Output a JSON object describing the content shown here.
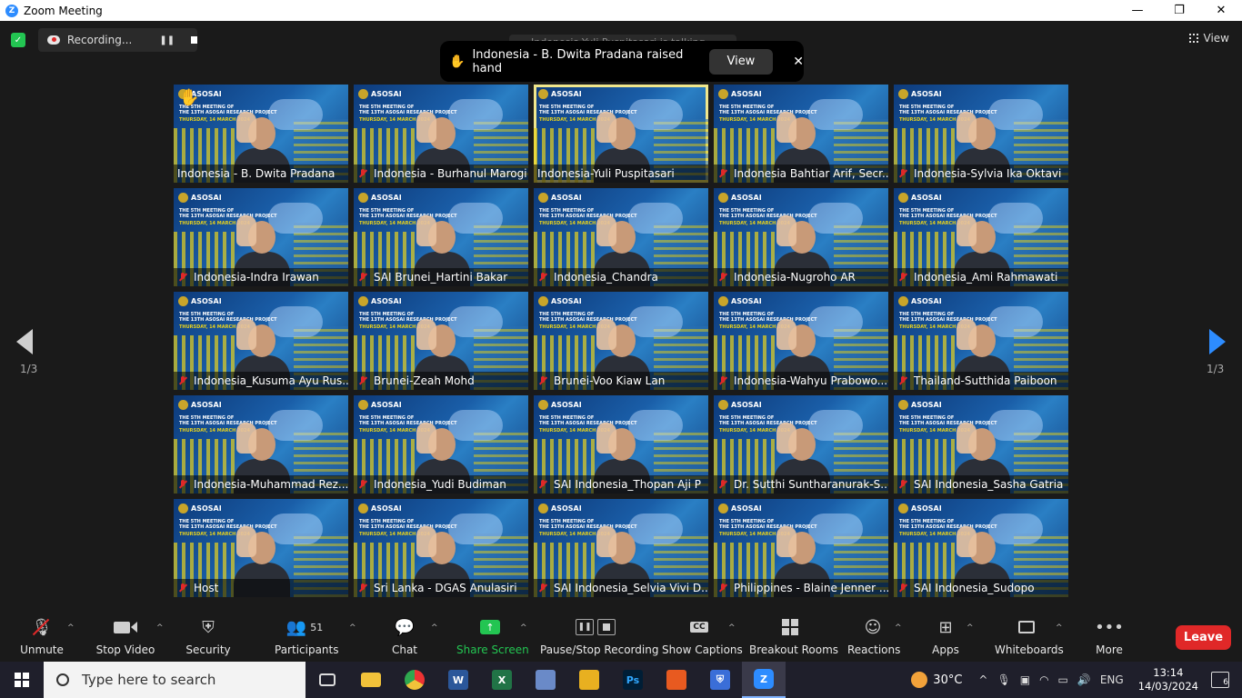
{
  "window": {
    "title": "Zoom Meeting",
    "minimize": "—",
    "maximize": "❐",
    "close": "✕"
  },
  "status": {
    "recording_label": "Recording...",
    "view_label": "View",
    "talking_text": "Indonesia-Yuli Puspitasari is talking..."
  },
  "notification": {
    "text": "Indonesia - B. Dwita Pradana raised hand",
    "view_label": "View",
    "close_label": "✕"
  },
  "tile_header": {
    "org": "ASOSAI",
    "line1": "THE 5TH MEETING OF",
    "line2": "THE 13TH ASOSAI RESEARCH PROJECT",
    "date": "THURSDAY, 14 MARCH 2024"
  },
  "participants": [
    {
      "name": "Indonesia - B. Dwita Pradana",
      "muted": false,
      "raised": true,
      "active": false
    },
    {
      "name": "Indonesia - Burhanul Marogi",
      "muted": true,
      "raised": false,
      "active": false
    },
    {
      "name": "Indonesia-Yuli Puspitasari",
      "muted": false,
      "raised": false,
      "active": true
    },
    {
      "name": "Indonesia Bahtiar Arif, Secr...",
      "muted": true,
      "raised": false,
      "active": false
    },
    {
      "name": "Indonesia-Sylvia Ika Oktavi",
      "muted": true,
      "raised": false,
      "active": false
    },
    {
      "name": "Indonesia-Indra Irawan",
      "muted": true,
      "raised": false,
      "active": false
    },
    {
      "name": "SAI Brunei_Hartini Bakar",
      "muted": true,
      "raised": false,
      "active": false
    },
    {
      "name": "Indonesia_Chandra",
      "muted": true,
      "raised": false,
      "active": false
    },
    {
      "name": "Indonesia-Nugroho AR",
      "muted": true,
      "raised": false,
      "active": false
    },
    {
      "name": "Indonesia_Ami Rahmawati",
      "muted": true,
      "raised": false,
      "active": false
    },
    {
      "name": "Indonesia_Kusuma Ayu Rus...",
      "muted": true,
      "raised": false,
      "active": false
    },
    {
      "name": "Brunei-Zeah Mohd",
      "muted": true,
      "raised": false,
      "active": false
    },
    {
      "name": "Brunei-Voo Kiaw Lan",
      "muted": true,
      "raised": false,
      "active": false
    },
    {
      "name": "Indonesia-Wahyu Prabowo...",
      "muted": true,
      "raised": false,
      "active": false
    },
    {
      "name": "Thailand-Sutthida Paiboon",
      "muted": true,
      "raised": false,
      "active": false
    },
    {
      "name": "Indonesia-Muhammad Rez...",
      "muted": true,
      "raised": false,
      "active": false
    },
    {
      "name": "Indonesia_Yudi Budiman",
      "muted": true,
      "raised": false,
      "active": false
    },
    {
      "name": "SAI Indonesia_Thopan Aji P",
      "muted": true,
      "raised": false,
      "active": false
    },
    {
      "name": "Dr. Sutthi Suntharanurak-S...",
      "muted": true,
      "raised": false,
      "active": false
    },
    {
      "name": "SAI Indonesia_Sasha Gatria",
      "muted": true,
      "raised": false,
      "active": false
    },
    {
      "name": "Host",
      "muted": true,
      "raised": false,
      "active": false
    },
    {
      "name": "Sri Lanka - DGAS Anulasiri",
      "muted": true,
      "raised": false,
      "active": false
    },
    {
      "name": "SAI Indonesia_Selvia Vivi D...",
      "muted": true,
      "raised": false,
      "active": false
    },
    {
      "name": "Philippines - Blaine Jenner ...",
      "muted": true,
      "raised": false,
      "active": false
    },
    {
      "name": "SAI Indonesia_Sudopo",
      "muted": true,
      "raised": false,
      "active": false
    }
  ],
  "pagination": {
    "left": "1/3",
    "right": "1/3"
  },
  "toolbar": {
    "unmute": "Unmute",
    "stop_video": "Stop Video",
    "security": "Security",
    "participants": "Participants",
    "participants_count": "51",
    "chat": "Chat",
    "share_screen": "Share Screen",
    "pause_stop_recording": "Pause/Stop Recording",
    "show_captions": "Show Captions",
    "cc_icon": "CC",
    "breakout_rooms": "Breakout Rooms",
    "reactions": "Reactions",
    "apps": "Apps",
    "whiteboards": "Whiteboards",
    "more": "More",
    "leave": "Leave"
  },
  "taskbar": {
    "search_placeholder": "Type here to search",
    "apps": [
      "task-view",
      "file-explorer",
      "chrome",
      "word",
      "excel",
      "app-6",
      "sintag",
      "photoshop",
      "app-9",
      "security-app",
      "zoom"
    ],
    "weather": "30°C",
    "language": "ENG",
    "time": "13:14",
    "date": "14/03/2024",
    "notification_count": "6"
  },
  "colors": {
    "accent": "#2d8cff",
    "leave": "#e02828",
    "share": "#23c552",
    "active_border": "#f0e68c"
  }
}
